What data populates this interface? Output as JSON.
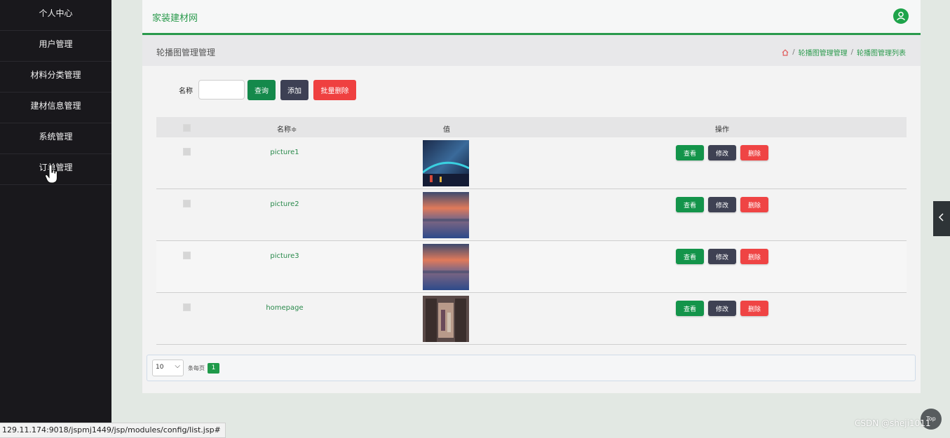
{
  "sidebar": {
    "items": [
      {
        "label": "个人中心"
      },
      {
        "label": "用户管理"
      },
      {
        "label": "材料分类管理"
      },
      {
        "label": "建材信息管理"
      },
      {
        "label": "系统管理"
      },
      {
        "label": "订单管理"
      }
    ]
  },
  "header": {
    "brand": "家装建材网",
    "user_icon": "user-icon"
  },
  "crumbbar": {
    "title": "轮播图管理管理",
    "breadcrumb": [
      "轮播图管理管理",
      "轮播图管理列表"
    ],
    "home_icon": "home-icon"
  },
  "search": {
    "label": "名称",
    "input_value": "",
    "query_label": "查询",
    "add_label": "添加",
    "batch_delete_label": "批量删除"
  },
  "table": {
    "columns": [
      "名称≑",
      "值",
      "操作"
    ],
    "rows": [
      {
        "name": "picture1",
        "image": "blue bridge night scene"
      },
      {
        "name": "picture2",
        "image": "sunset over water"
      },
      {
        "name": "picture3",
        "image": "sunset over water"
      },
      {
        "name": "homepage",
        "image": "interior hallway"
      }
    ],
    "actions": {
      "view": "查看",
      "edit": "修改",
      "delete": "删除"
    }
  },
  "pagination": {
    "page_size": "10",
    "per_page_text": "条每页",
    "current_page": "1"
  },
  "top_button": "Top",
  "status_url": "129.11.174:9018/jspmj1449/jsp/modules/config/list.jsp#",
  "watermark": "CSDN @sheji1011",
  "colors": {
    "accent": "#2a9a4c",
    "sidebar_bg": "#19181c",
    "danger": "#ef4444",
    "dark_button": "#3e4153"
  }
}
